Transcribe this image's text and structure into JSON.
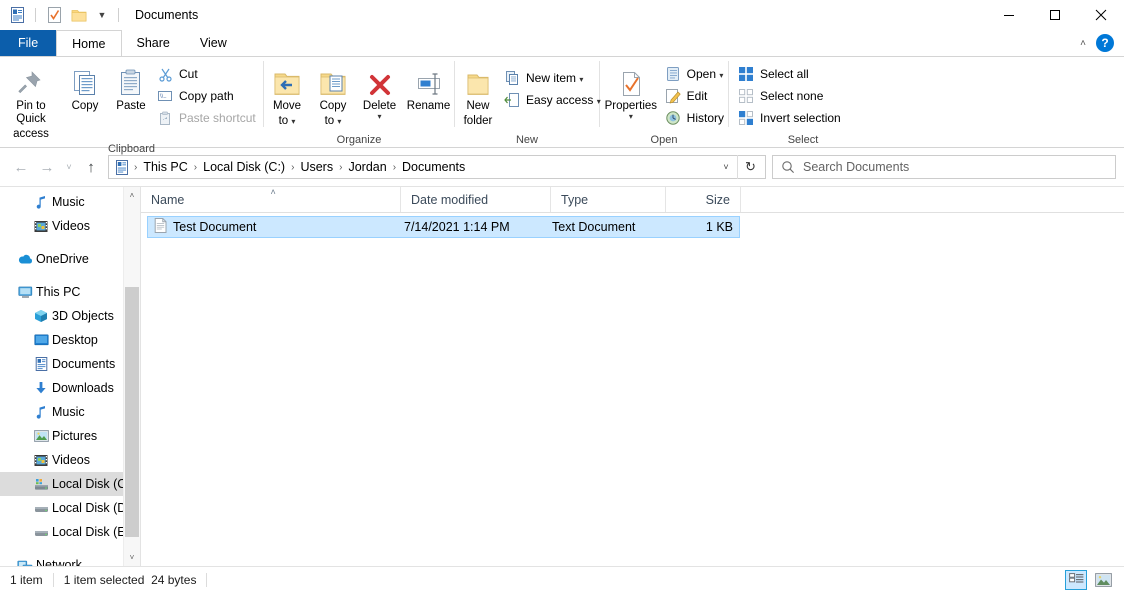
{
  "window": {
    "title": "Documents",
    "quick_access": [
      {
        "name": "properties-doc-icon",
        "label": "Properties"
      },
      {
        "name": "checkmark-properties-icon",
        "label": "Properties"
      },
      {
        "name": "new-folder-icon",
        "label": "New folder"
      },
      {
        "name": "chevron-down-icon",
        "label": "Customize Quick Access Toolbar"
      }
    ],
    "controls": {
      "minimize": "—",
      "maximize": "☐",
      "close": "✕"
    }
  },
  "tabs": [
    {
      "label": "File",
      "kind": "file"
    },
    {
      "label": "Home",
      "kind": "active"
    },
    {
      "label": "Share",
      "kind": "normal"
    },
    {
      "label": "View",
      "kind": "normal"
    }
  ],
  "ribbon": {
    "collapse_label": "˄",
    "help_label": "?",
    "groups": [
      {
        "name": "Clipboard",
        "big": [
          {
            "label": "Pin to Quick",
            "label2": "access",
            "icon": "pin-icon",
            "disabled": false
          },
          {
            "label": "Copy",
            "icon": "copy-icon",
            "disabled": false
          },
          {
            "label": "Paste",
            "icon": "paste-icon",
            "disabled": false
          }
        ],
        "small": [
          {
            "label": "Cut",
            "icon": "cut-icon",
            "disabled": false
          },
          {
            "label": "Copy path",
            "icon": "copy-path-icon",
            "disabled": false
          },
          {
            "label": "Paste shortcut",
            "icon": "paste-shortcut-icon",
            "disabled": true
          }
        ]
      },
      {
        "name": "Organize",
        "big": [
          {
            "label": "Move",
            "label2": "to",
            "icon": "move-to-icon",
            "caret": true
          },
          {
            "label": "Copy",
            "label2": "to",
            "icon": "copy-to-icon",
            "caret": true
          },
          {
            "label": "Delete",
            "icon": "delete-icon",
            "caret": true
          },
          {
            "label": "Rename",
            "icon": "rename-icon",
            "caret": false
          }
        ],
        "small": []
      },
      {
        "name": "New",
        "big": [
          {
            "label": "New",
            "label2": "folder",
            "icon": "new-folder-icon",
            "caret": false
          }
        ],
        "small": [
          {
            "label": "New item",
            "icon": "new-item-icon",
            "caret": true
          },
          {
            "label": "Easy access",
            "icon": "easy-access-icon",
            "caret": true
          }
        ]
      },
      {
        "name": "Open",
        "big": [
          {
            "label": "Properties",
            "icon": "properties-icon",
            "caret": true
          }
        ],
        "small": [
          {
            "label": "Open",
            "icon": "open-icon",
            "caret": true
          },
          {
            "label": "Edit",
            "icon": "edit-icon",
            "caret": false
          },
          {
            "label": "History",
            "icon": "history-icon",
            "caret": false
          }
        ]
      },
      {
        "name": "Select",
        "big": [],
        "small": [
          {
            "label": "Select all",
            "icon": "select-all-icon"
          },
          {
            "label": "Select none",
            "icon": "select-none-icon"
          },
          {
            "label": "Invert selection",
            "icon": "invert-selection-icon"
          }
        ]
      }
    ]
  },
  "addressbar": {
    "back_label": "←",
    "forward_label": "→",
    "recent_label": "˅",
    "up_label": "↑",
    "breadcrumbs": [
      "This PC",
      "Local Disk (C:)",
      "Users",
      "Jordan",
      "Documents"
    ],
    "separator": "›",
    "dropdown_label": "˅",
    "refresh_label": "↻",
    "search_placeholder": "Search Documents",
    "search_value": ""
  },
  "sidebar": {
    "items": [
      {
        "label": "Music",
        "icon": "music-note-icon",
        "level": 1,
        "selected": false,
        "gap_before": false
      },
      {
        "label": "Videos",
        "icon": "videos-filmstrip-icon",
        "level": 1,
        "selected": false,
        "gap_before": false
      },
      {
        "label": "OneDrive",
        "icon": "onedrive-cloud-icon",
        "level": 0,
        "selected": false,
        "gap_before": true
      },
      {
        "label": "This PC",
        "icon": "this-pc-monitor-icon",
        "level": 0,
        "selected": false,
        "gap_before": true
      },
      {
        "label": "3D Objects",
        "icon": "3d-objects-icon",
        "level": 1,
        "selected": false,
        "gap_before": false
      },
      {
        "label": "Desktop",
        "icon": "desktop-icon",
        "level": 1,
        "selected": false,
        "gap_before": false
      },
      {
        "label": "Documents",
        "icon": "documents-icon",
        "level": 1,
        "selected": false,
        "gap_before": false
      },
      {
        "label": "Downloads",
        "icon": "downloads-arrow-icon",
        "level": 1,
        "selected": false,
        "gap_before": false
      },
      {
        "label": "Music",
        "icon": "music-note-icon",
        "level": 1,
        "selected": false,
        "gap_before": false
      },
      {
        "label": "Pictures",
        "icon": "pictures-icon",
        "level": 1,
        "selected": false,
        "gap_before": false
      },
      {
        "label": "Videos",
        "icon": "videos-filmstrip-icon",
        "level": 1,
        "selected": false,
        "gap_before": false
      },
      {
        "label": "Local Disk (C:)",
        "icon": "local-disk-c-icon",
        "level": 1,
        "selected": true,
        "gap_before": false
      },
      {
        "label": "Local Disk (D:)",
        "icon": "local-disk-icon",
        "level": 1,
        "selected": false,
        "gap_before": false
      },
      {
        "label": "Local Disk (E:)",
        "icon": "local-disk-icon",
        "level": 1,
        "selected": false,
        "gap_before": false
      },
      {
        "label": "Network",
        "icon": "network-icon",
        "level": 0,
        "selected": false,
        "gap_before": true
      }
    ],
    "scroll_up": "˄",
    "scroll_down": "˅"
  },
  "filelist": {
    "columns": [
      {
        "label": "Name",
        "sorted": true,
        "sort_glyph": "˄"
      },
      {
        "label": "Date modified",
        "sorted": false
      },
      {
        "label": "Type",
        "sorted": false
      },
      {
        "label": "Size",
        "sorted": false
      }
    ],
    "rows": [
      {
        "name": "Test Document",
        "date_modified": "7/14/2021 1:14 PM",
        "type": "Text Document",
        "size": "1 KB",
        "icon": "text-document-icon",
        "selected": true
      }
    ]
  },
  "statusbar": {
    "item_count": "1 item",
    "selection": "1 item selected",
    "selection_size": "24 bytes",
    "views": [
      {
        "name": "details-view-button",
        "label": "Details",
        "active": true
      },
      {
        "name": "large-icons-view-button",
        "label": "Large icons",
        "active": false
      }
    ]
  }
}
